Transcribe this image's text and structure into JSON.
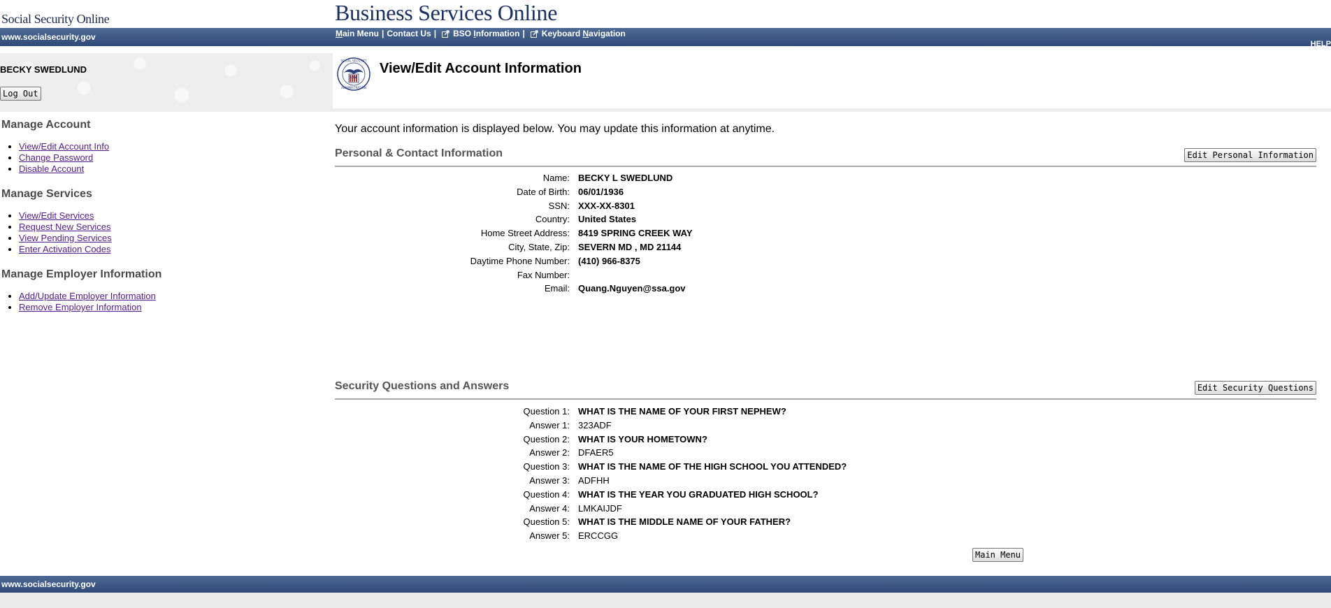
{
  "header": {
    "site_name": "Social Security Online",
    "app_title": "Business Services Online",
    "domain": "www.socialsecurity.gov",
    "help": "HELP"
  },
  "topnav": {
    "main_menu": {
      "first": "M",
      "rest": "ain Menu"
    },
    "contact_us": "Contact Us",
    "bso_info": {
      "pre": "BSO ",
      "u": "I",
      "rest": "nformation"
    },
    "keyboard_nav": {
      "pre": "Keyboard ",
      "u": "N",
      "rest": "avigation"
    },
    "separator": "|"
  },
  "user": {
    "name": "BECKY SWEDLUND",
    "logout_label": "Log Out"
  },
  "page": {
    "title": "View/Edit Account Information",
    "intro": "Your account information is displayed below. You may update this information at anytime."
  },
  "sidebar": {
    "sections": [
      {
        "heading": "Manage Account",
        "items": [
          "View/Edit Account Info",
          "Change Password",
          "Disable Account"
        ]
      },
      {
        "heading": "Manage Services",
        "items": [
          "View/Edit Services",
          "Request New Services",
          "View Pending Services",
          "Enter Activation Codes"
        ]
      },
      {
        "heading": "Manage Employer Information",
        "items": [
          "Add/Update Employer Information",
          "Remove Employer Information"
        ]
      }
    ]
  },
  "personal": {
    "title": "Personal & Contact Information",
    "edit_label": "Edit Personal Information",
    "rows": [
      {
        "label": "Name:",
        "value": "BECKY L SWEDLUND"
      },
      {
        "label": "Date of Birth:",
        "value": "06/01/1936"
      },
      {
        "label": "SSN:",
        "value": "XXX-XX-8301"
      },
      {
        "label": "Country:",
        "value": "United States"
      },
      {
        "label": "Home Street Address:",
        "value": "8419 SPRING CREEK WAY"
      },
      {
        "label": "City, State, Zip:",
        "value": "SEVERN MD , MD 21144"
      },
      {
        "label": "Daytime Phone Number:",
        "value": "(410) 966-8375"
      },
      {
        "label": "Fax Number:",
        "value": ""
      },
      {
        "label": "Email:",
        "value": "Quang.Nguyen@ssa.gov"
      }
    ]
  },
  "security": {
    "title": "Security Questions and Answers",
    "edit_label": "Edit Security Questions",
    "rows": [
      {
        "label": "Question 1:",
        "value": "WHAT IS THE NAME OF YOUR FIRST NEPHEW?"
      },
      {
        "label": "Answer 1:",
        "value": "323ADF"
      },
      {
        "label": "Question 2:",
        "value": "WHAT IS YOUR HOMETOWN?"
      },
      {
        "label": "Answer 2:",
        "value": "DFAER5"
      },
      {
        "label": "Question 3:",
        "value": "WHAT IS THE NAME OF THE HIGH SCHOOL YOU ATTENDED?"
      },
      {
        "label": "Answer 3:",
        "value": "ADFHH"
      },
      {
        "label": "Question 4:",
        "value": "WHAT IS THE YEAR YOU GRADUATED HIGH SCHOOL?"
      },
      {
        "label": "Answer 4:",
        "value": "LMKAIJDF"
      },
      {
        "label": "Question 5:",
        "value": "WHAT IS THE MIDDLE NAME OF YOUR FATHER?"
      },
      {
        "label": "Answer 5:",
        "value": "ERCCGG"
      }
    ]
  },
  "main_menu_label": "Main Menu",
  "footer": {
    "domain": "www.socialsecurity.gov"
  },
  "icons": {
    "seal": "ssa-seal-icon",
    "external": "external-link-icon"
  },
  "seal": {
    "top_text": "SOCIAL SECURITY",
    "bottom_text": "ADMINISTRATION",
    "center_text": "USA"
  },
  "colors": {
    "bar_top": "#4d6a95",
    "bar_bottom": "#2f4a76",
    "link": "#551a8b",
    "heading": "#4a4a4a"
  }
}
